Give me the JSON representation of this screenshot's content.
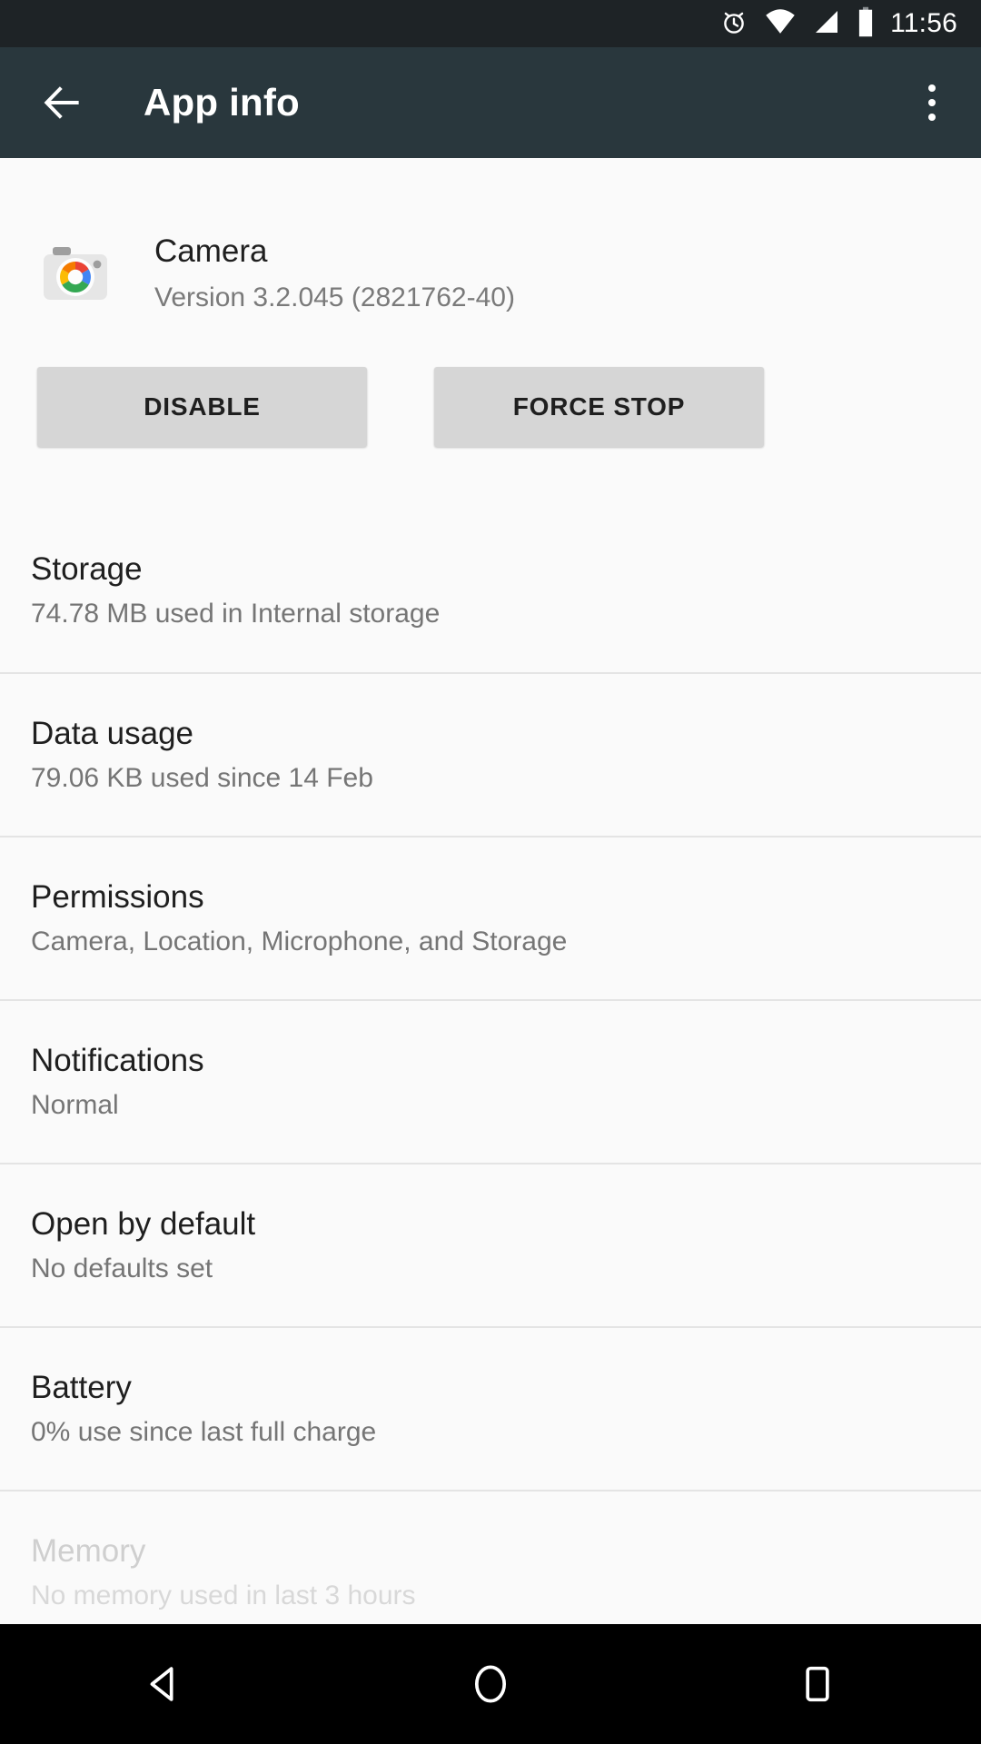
{
  "status_bar": {
    "time": "11:56",
    "icons": [
      "alarm-icon",
      "wifi-icon",
      "cellular-signal-icon",
      "battery-icon"
    ],
    "background": "#1e2326"
  },
  "toolbar": {
    "title": "App info",
    "back_icon": "back-arrow-icon",
    "overflow_icon": "overflow-menu-icon",
    "background": "#29373d"
  },
  "app": {
    "name": "Camera",
    "version": "Version 3.2.045 (2821762-40)",
    "icon": "google-camera-icon"
  },
  "actions": {
    "disable_label": "DISABLE",
    "force_stop_label": "FORCE STOP",
    "button_color": "#d6d6d6"
  },
  "settings_list": [
    {
      "title": "Storage",
      "subtitle": "74.78 MB used in Internal storage",
      "faded": false
    },
    {
      "title": "Data usage",
      "subtitle": "79.06 KB used since 14 Feb",
      "faded": false
    },
    {
      "title": "Permissions",
      "subtitle": "Camera, Location, Microphone, and Storage",
      "faded": false
    },
    {
      "title": "Notifications",
      "subtitle": "Normal",
      "faded": false
    },
    {
      "title": "Open by default",
      "subtitle": "No defaults set",
      "faded": false
    },
    {
      "title": "Battery",
      "subtitle": "0% use since last full charge",
      "faded": false
    },
    {
      "title": "Memory",
      "subtitle": "No memory used in last 3 hours",
      "faded": true
    }
  ],
  "nav_bar": {
    "back": "nav-back-icon",
    "home": "nav-home-icon",
    "recents": "nav-recents-icon",
    "background": "#000000"
  }
}
